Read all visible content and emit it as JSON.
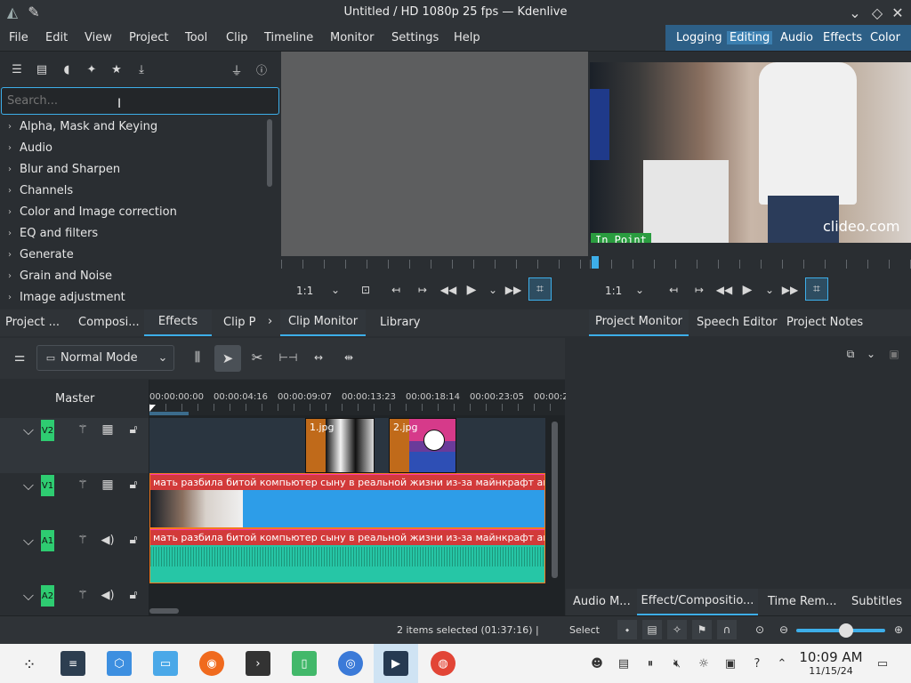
{
  "window": {
    "title": "Untitled / HD 1080p 25 fps — Kdenlive"
  },
  "menu": [
    "File",
    "Edit",
    "View",
    "Project",
    "Tool",
    "Clip",
    "Timeline",
    "Monitor",
    "Settings",
    "Help"
  ],
  "layouts": [
    "Logging",
    "Editing",
    "Audio",
    "Effects",
    "Color"
  ],
  "effects_panel": {
    "search_placeholder": "Search...",
    "categories": [
      "Alpha, Mask and Keying",
      "Audio",
      "Blur and Sharpen",
      "Channels",
      "Color and Image correction",
      "EQ and filters",
      "Generate",
      "Grain and Noise",
      "Image adjustment"
    ],
    "tabs": [
      "Project ...",
      "Composi...",
      "Effects",
      "Clip P"
    ]
  },
  "clip_monitor": {
    "zoom": "1:1",
    "tabs": [
      "Clip Monitor",
      "Library"
    ]
  },
  "project_monitor": {
    "zoom": "1:1",
    "in_point_label": "In Point",
    "watermark": "clideo.com",
    "tabs": [
      "Project Monitor",
      "Speech Editor",
      "Project Notes"
    ]
  },
  "timeline": {
    "mode": "Normal Mode",
    "master_label": "Master",
    "timecodes": [
      "00:00:00:00",
      "00:00:04:16",
      "00:00:09:07",
      "00:00:13:23",
      "00:00:18:14",
      "00:00:23:05",
      "00:00:2"
    ],
    "tracks": [
      "V2",
      "V1",
      "A1",
      "A2"
    ],
    "clip1": "1.jpg",
    "clip2": "2.jpg",
    "video_clip_title": "мать разбила битой компьютер сыну в реальной жизни из-за майнкрафт анти-гри",
    "audio_clip_title": "мать разбила битой компьютер сыну в реальной жизни из-за майнкрафт анти-гри"
  },
  "lower_right_tabs": [
    "Audio M...",
    "Effect/Compositio...",
    "Time Rem...",
    "Subtitles"
  ],
  "status": {
    "selection": "2 items selected (01:37:16) |",
    "tool": "Select"
  },
  "taskbar": {
    "time": "10:09 AM",
    "date": "11/15/24"
  },
  "colors": {
    "accent": "#3daee9",
    "track_badge": "#2ecc71",
    "video_clip": "#2d9de8",
    "audio_clip": "#26c6a6",
    "clip_title": "#d23a3a"
  }
}
